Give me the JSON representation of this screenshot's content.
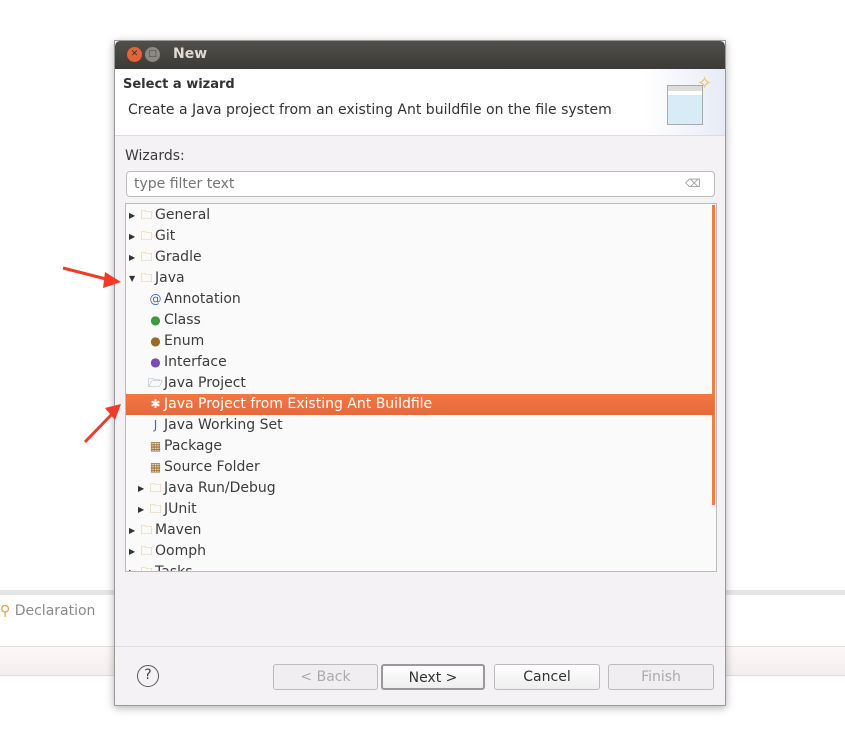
{
  "background": {
    "declaration_label": "Declaration"
  },
  "dialog": {
    "title": "New",
    "header": {
      "title": "Select a wizard",
      "description": "Create a Java project from an existing Ant buildfile on the file system"
    },
    "wizards_label": "Wizards:",
    "filter": {
      "value": "",
      "placeholder": "type filter text"
    },
    "tree": [
      {
        "label": "General",
        "level": 0,
        "expander": "collapsed",
        "icon": "folder-icon"
      },
      {
        "label": "Git",
        "level": 0,
        "expander": "collapsed",
        "icon": "folder-icon"
      },
      {
        "label": "Gradle",
        "level": 0,
        "expander": "collapsed",
        "icon": "folder-icon"
      },
      {
        "label": "Java",
        "level": 0,
        "expander": "expanded",
        "icon": "folder-icon"
      },
      {
        "label": "Annotation",
        "level": 1,
        "icon": "annotation-icon"
      },
      {
        "label": "Class",
        "level": 1,
        "icon": "class-icon"
      },
      {
        "label": "Enum",
        "level": 1,
        "icon": "enum-icon"
      },
      {
        "label": "Interface",
        "level": 1,
        "icon": "interface-icon"
      },
      {
        "label": "Java Project",
        "level": 1,
        "icon": "java-project-icon"
      },
      {
        "label": "Java Project from Existing Ant Buildfile",
        "level": 1,
        "icon": "ant-icon",
        "selected": true
      },
      {
        "label": "Java Working Set",
        "level": 1,
        "icon": "working-set-icon"
      },
      {
        "label": "Package",
        "level": 1,
        "icon": "package-icon"
      },
      {
        "label": "Source Folder",
        "level": 1,
        "icon": "source-folder-icon"
      },
      {
        "label": "Java Run/Debug",
        "level": 1,
        "expander": "collapsed",
        "icon": "folder-icon"
      },
      {
        "label": "JUnit",
        "level": 1,
        "expander": "collapsed",
        "icon": "folder-icon"
      },
      {
        "label": "Maven",
        "level": 0,
        "expander": "collapsed",
        "icon": "folder-icon"
      },
      {
        "label": "Oomph",
        "level": 0,
        "expander": "collapsed",
        "icon": "folder-icon"
      },
      {
        "label": "Tasks",
        "level": 0,
        "expander": "collapsed",
        "icon": "folder-icon"
      }
    ],
    "buttons": {
      "back": "< Back",
      "next": "Next >",
      "cancel": "Cancel",
      "finish": "Finish",
      "help": "?"
    },
    "accent": "#f07746"
  }
}
